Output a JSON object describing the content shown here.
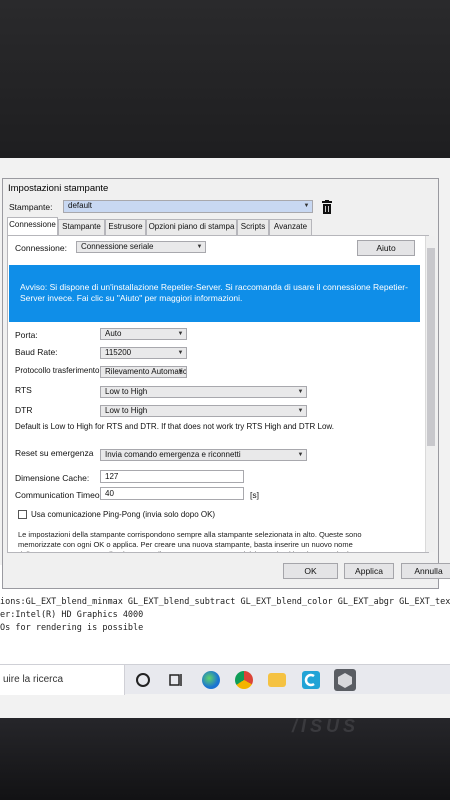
{
  "dialog": {
    "title": "Impostazioni stampante",
    "printer_label": "Stampante:",
    "printer_value": "default"
  },
  "tabs": [
    {
      "label": "Connessione"
    },
    {
      "label": "Stampante"
    },
    {
      "label": "Estrusore"
    },
    {
      "label": "Opzioni piano di stampa"
    },
    {
      "label": "Scripts"
    },
    {
      "label": "Avanzate"
    }
  ],
  "connection": {
    "label": "Connessione:",
    "value": "Connessione seriale",
    "help_button": "Aiuto"
  },
  "info_banner": {
    "text": "Avviso: Si dispone di un'installazione Repetier-Server. Si raccomanda di usare il connessione Repetier-Server invece. Fai clic su \"Aiuto\" per maggiori informazioni."
  },
  "fields": {
    "port_label": "Porta:",
    "port_value": "Auto",
    "baud_label": "Baud Rate:",
    "baud_value": "115200",
    "protocol_label": "Protocollo trasferimento:",
    "protocol_value": "Rilevamento Automatico",
    "rts_label": "RTS",
    "rts_value": "Low to High",
    "dtr_label": "DTR",
    "dtr_value": "Low to High",
    "default_note": "Default is Low to High for RTS and DTR. If that does not work try RTS High and DTR Low.",
    "reset_label": "Reset su emergenza",
    "reset_value": "Invia comando emergenza e riconnetti",
    "cache_label": "Dimensione Cache:",
    "cache_value": "127",
    "timeout_label": "Communication Timeout:",
    "timeout_value": "40",
    "timeout_unit": "[s]",
    "pingpong_label": "Usa comunicazione Ping-Pong (invia solo dopo OK)",
    "pingpong_checked": false
  },
  "footer_note": "Le impostazioni della stampante corrispondono sempre alla stampante selezionata in alto. Queste sono memorizzate con ogni OK o applica. Per creare una nuova stampante, basta inserire un nuovo nome della stampante e premere il pulsante Applica. La nuova stampante inizia con le ultime impostazioni",
  "buttons": {
    "ok": "OK",
    "apply": "Applica",
    "cancel": "Annulla"
  },
  "console": {
    "lines": [
      "ions:GL_EXT_blend_minmax GL_EXT_blend_subtract GL_EXT_blend_color GL_EXT_abgr GL_EXT_text",
      "er:Intel(R) HD Graphics 4000",
      "Os for rendering is possible"
    ]
  },
  "taskbar": {
    "search_text": "uire la ricerca"
  },
  "icons": [
    "delete-printer-icon",
    "search-circle-icon",
    "task-view-icon",
    "edge-icon",
    "chrome-icon",
    "file-explorer-icon",
    "cura-icon",
    "repetier-host-icon"
  ],
  "colors": {
    "info_banner": "#0f8ee8",
    "screen_bg": "#f0f0f0"
  }
}
